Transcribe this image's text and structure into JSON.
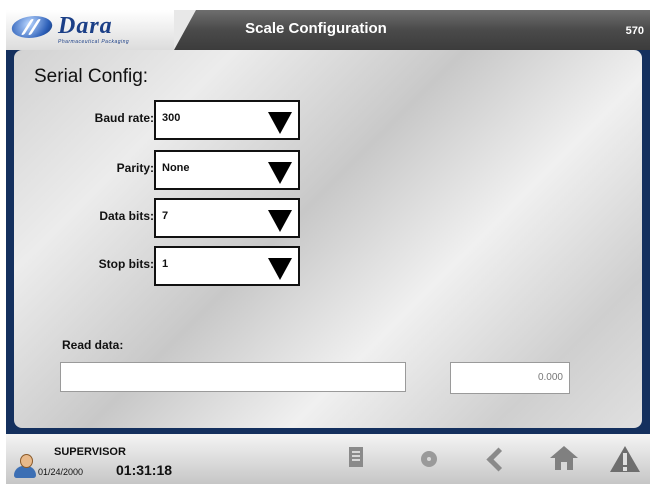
{
  "header": {
    "logo_text": "Dara",
    "logo_tagline": "Pharmaceutical Packaging",
    "title": "Scale Configuration",
    "code": "570"
  },
  "panel": {
    "title": "Serial Config:",
    "fields": [
      {
        "label": "Baud rate:",
        "value": "300"
      },
      {
        "label": "Parity:",
        "value": "None"
      },
      {
        "label": "Data bits:",
        "value": "7"
      },
      {
        "label": "Stop bits:",
        "value": "1"
      }
    ],
    "read_data_label": "Read data:",
    "read_data_input": "",
    "read_value": "0.000"
  },
  "footer": {
    "user": "SUPERVISOR",
    "date": "01/24/2000",
    "time": "01:31:18",
    "icons": [
      "document-icon",
      "gear-icon",
      "back-icon",
      "home-icon",
      "warning-icon"
    ]
  }
}
